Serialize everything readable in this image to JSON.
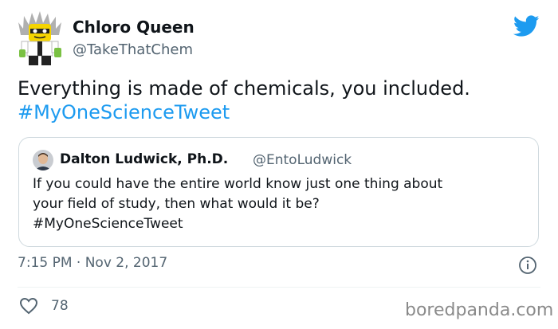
{
  "tweet": {
    "author": {
      "name": "Chloro Queen",
      "handle": "@TakeThatChem",
      "avatar": "lego-scientist-avatar"
    },
    "text_line1": "Everything is made of chemicals, you included.",
    "hashtag": "#MyOneScienceTweet",
    "quoted": {
      "name": "Dalton Ludwick, Ph.D.",
      "handle": "@EntoLudwick",
      "avatar": "man-portrait-avatar",
      "text_line1": "If you could have the entire world know just one thing about",
      "text_line2": "your field of study, then what would it be?",
      "hashtag": "#MyOneScienceTweet"
    },
    "timestamp": "7:15 PM · Nov 2, 2017",
    "likes": "78"
  },
  "icons": {
    "brand": "twitter-bird-icon",
    "info": "info-icon",
    "like": "heart-icon"
  },
  "colors": {
    "link": "#1d9bf0",
    "muted": "#536471",
    "text": "#0f1419",
    "border": "#cfd9de"
  },
  "watermark": "boredpanda.com"
}
